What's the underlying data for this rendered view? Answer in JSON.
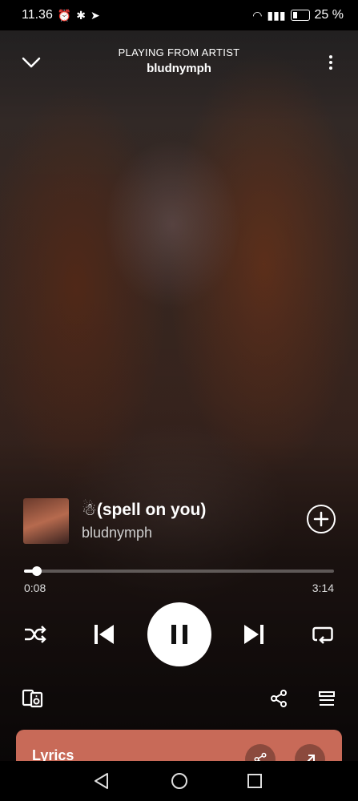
{
  "status_bar": {
    "time": "11.36",
    "battery": "25 %"
  },
  "header": {
    "context_label": "PLAYING FROM ARTIST",
    "context_name": "bludnymph"
  },
  "track": {
    "title": "☃(spell on you)",
    "artist": "bludnymph"
  },
  "playback": {
    "elapsed": "0:08",
    "total": "3:14",
    "progress": 0.041
  },
  "lyrics": {
    "label": "Lyrics"
  },
  "icons": {
    "collapse": "chevron-down-icon",
    "menu": "more-vertical-icon",
    "add": "add-circle-icon",
    "shuffle": "shuffle-icon",
    "previous": "skip-previous-icon",
    "pause": "pause-icon",
    "next": "skip-next-icon",
    "repeat": "repeat-icon",
    "devices": "connect-device-icon",
    "share": "share-icon",
    "queue": "queue-icon"
  },
  "colors": {
    "lyrics_card": "#c86a58",
    "accent": "#ffffff"
  }
}
